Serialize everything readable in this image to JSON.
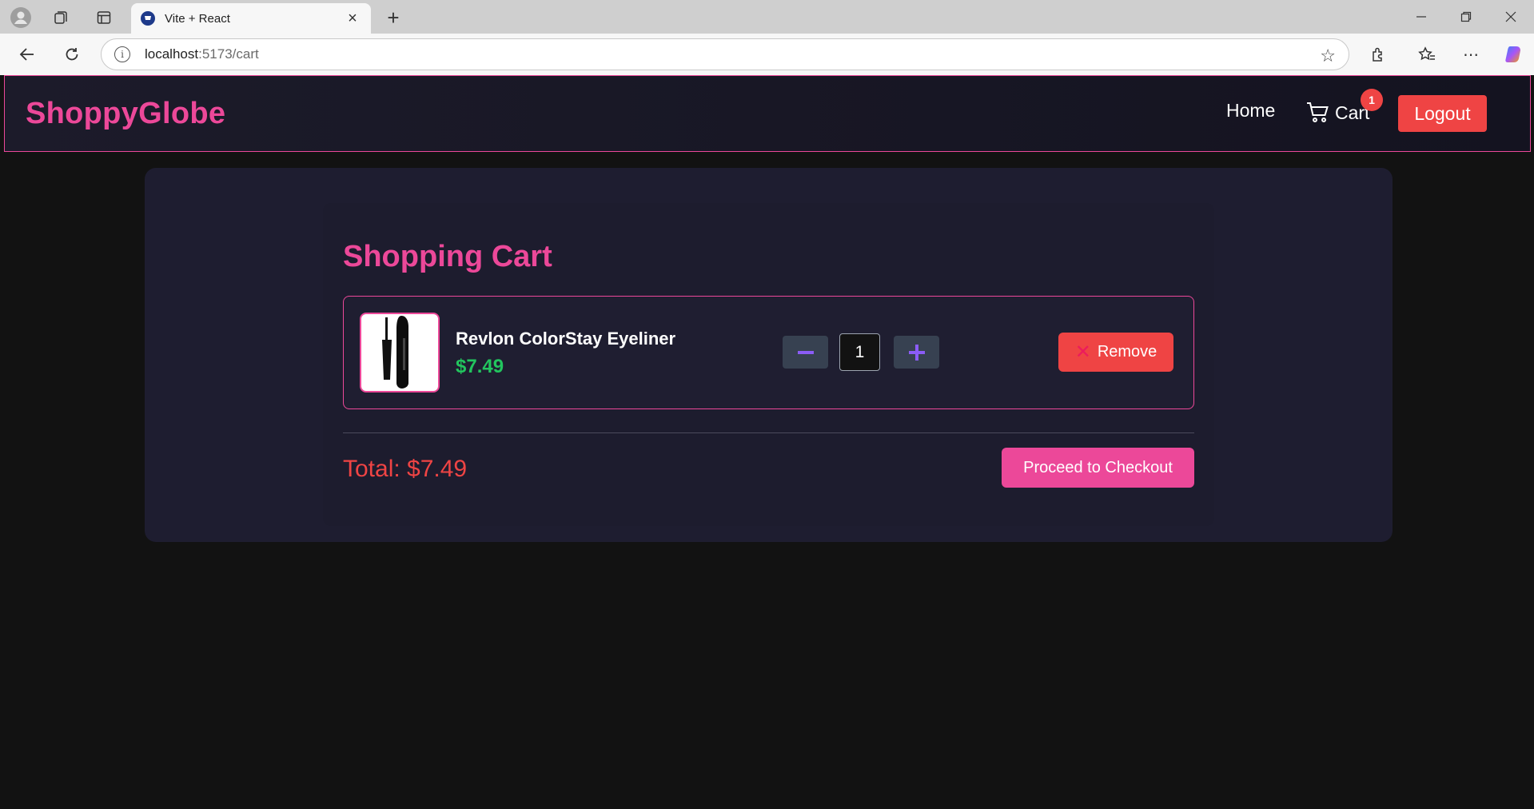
{
  "browser": {
    "tab_title": "Vite + React",
    "url_host": "localhost",
    "url_path": ":5173/cart"
  },
  "header": {
    "brand": "ShoppyGlobe",
    "nav_home": "Home",
    "nav_cart": "Cart",
    "cart_count": "1",
    "logout": "Logout"
  },
  "cart": {
    "title": "Shopping Cart",
    "items": [
      {
        "name": "Revlon ColorStay Eyeliner",
        "price": "$7.49",
        "quantity": "1",
        "decrement": "−",
        "increment": "+",
        "remove_label": "Remove",
        "remove_icon": "✕"
      }
    ],
    "total_label": "Total: $7.49",
    "checkout_label": "Proceed to Checkout"
  },
  "colors": {
    "accent_pink": "#ec4899",
    "danger_red": "#ef4444",
    "price_green": "#22c55e",
    "qty_purple": "#8b5cf6"
  }
}
